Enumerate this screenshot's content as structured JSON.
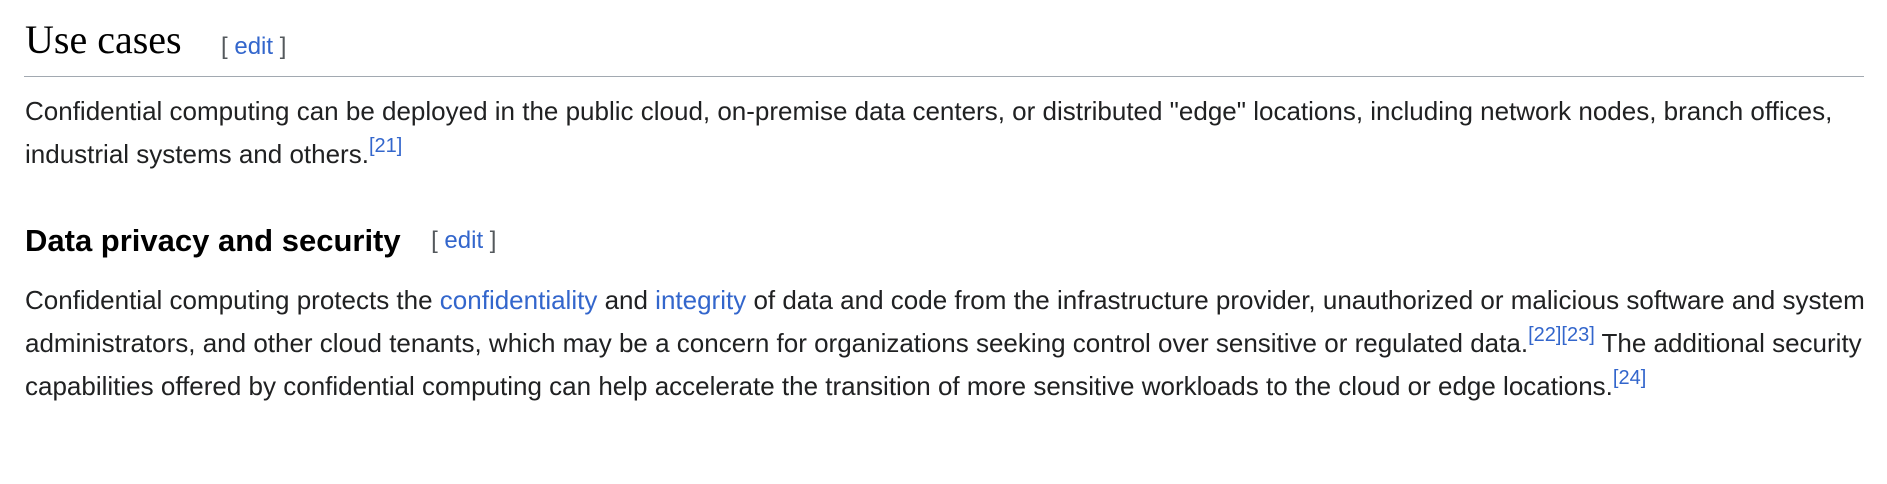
{
  "section_use_cases": {
    "title": "Use cases",
    "edit_open": "[ ",
    "edit_label": "edit",
    "edit_close": " ]",
    "paragraph": {
      "text": "Confidential computing can be deployed in the public cloud, on-premise data centers, or distributed \"edge\" locations, including network nodes, branch offices, industrial systems and others.",
      "refs": [
        "[21]"
      ]
    }
  },
  "section_data_privacy": {
    "title": "Data privacy and security",
    "edit_open": "[ ",
    "edit_label": "edit",
    "edit_close": " ]",
    "paragraph": {
      "text_1": "Confidential computing protects the ",
      "link_1": "confidentiality",
      "text_2": " and ",
      "link_2": "integrity",
      "text_3": " of data and code from the infrastructure provider, unauthorized or malicious software and system administrators, and other cloud tenants, which may be a concern for organizations seeking control over sensitive or regulated data.",
      "refs_a": [
        "[22]",
        "[23]"
      ],
      "text_4": " The additional security capabilities offered by confidential computing can help accelerate the transition of more sensitive workloads to the cloud or edge locations.",
      "refs_b": [
        "[24]"
      ]
    }
  },
  "colors": {
    "link": "#3366cc",
    "text": "#202122",
    "heading": "#000000",
    "divider": "#a2a9b1",
    "bracket": "#54595d"
  }
}
